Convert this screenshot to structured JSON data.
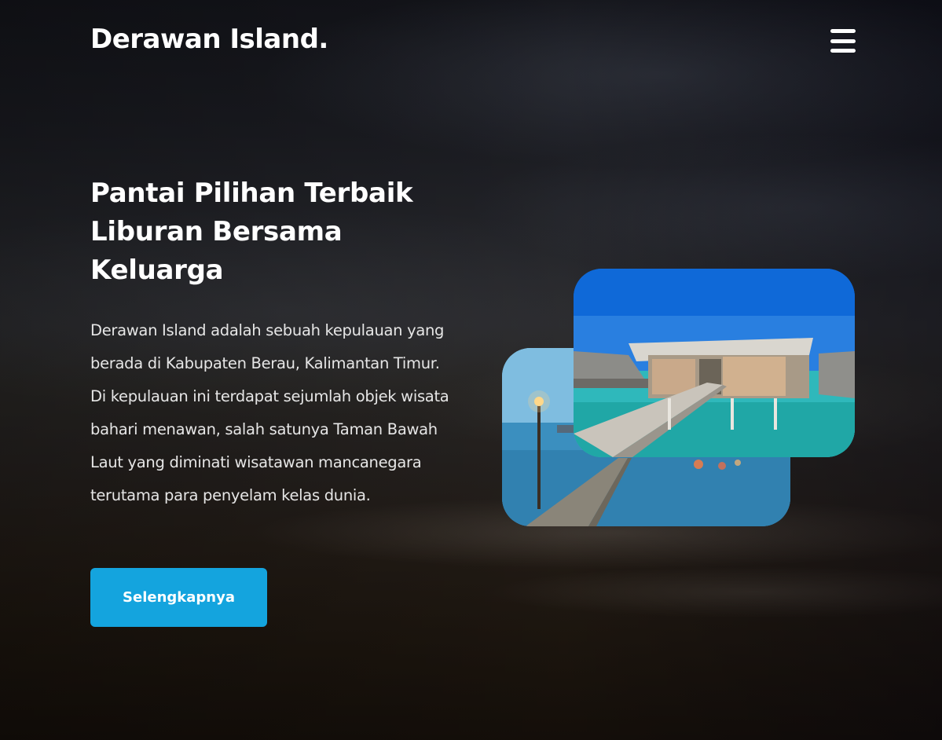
{
  "header": {
    "brand": "Derawan Island."
  },
  "hero": {
    "title_lines": [
      "Pantai Pilihan Terbaik",
      "Liburan Bersama",
      "Keluarga"
    ],
    "description": "Derawan Island adalah sebuah kepulauan yang berada di Kabupaten Berau, Kalimantan Timur. Di kepulauan ini terdapat sejumlah objek wisata bahari menawan, salah satunya Taman Bawah Laut yang diminati wisatawan mancanegara terutama para penyelam kelas dunia.",
    "cta_label": "Selengkapnya"
  },
  "icons": {
    "menu": "hamburger-menu-icon"
  },
  "colors": {
    "accent": "#14a4de",
    "text": "#ffffff"
  }
}
